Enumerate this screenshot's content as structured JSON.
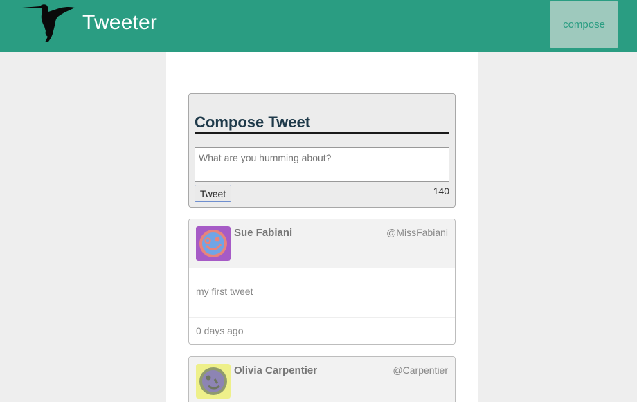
{
  "nav": {
    "brand": "Tweeter",
    "compose_label": "compose"
  },
  "compose": {
    "title": "Compose Tweet",
    "placeholder": "What are you humming about?",
    "submit_label": "Tweet",
    "counter": "140"
  },
  "tweets": [
    {
      "name": "Sue Fabiani",
      "handle": "@MissFabiani",
      "text": "my first tweet",
      "time": "0 days ago"
    },
    {
      "name": "Olivia Carpentier",
      "handle": "@Carpentier"
    }
  ]
}
